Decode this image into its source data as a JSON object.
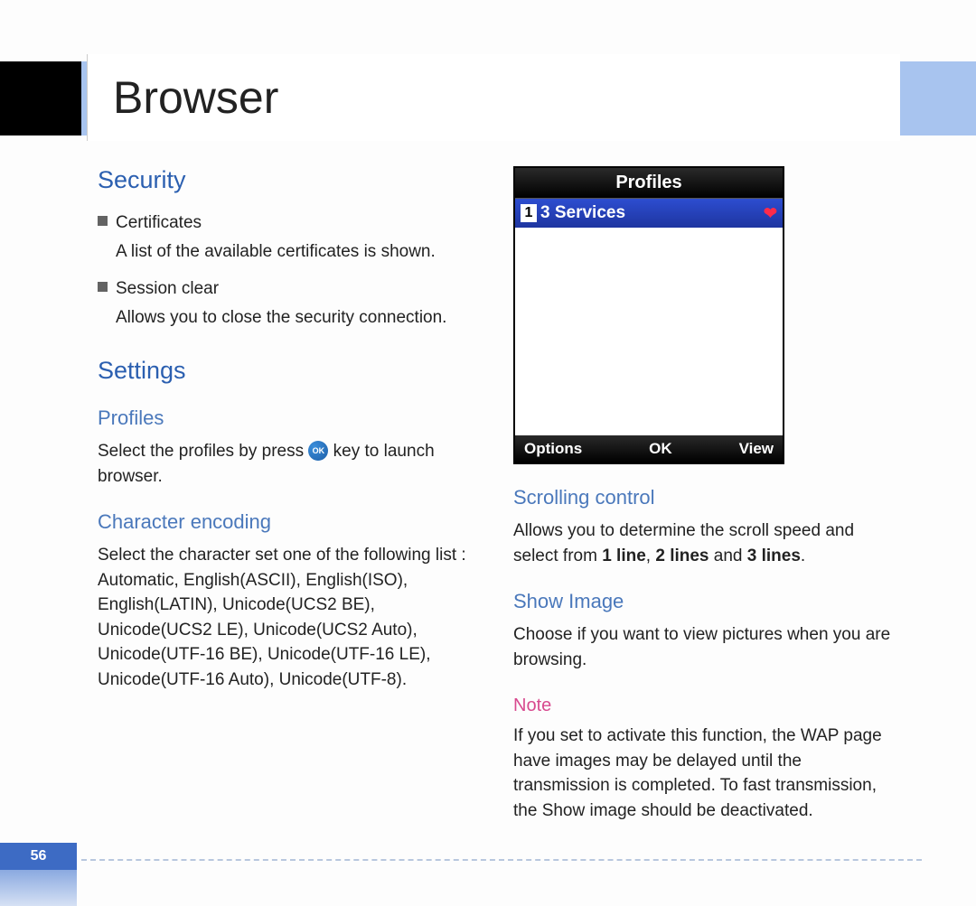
{
  "header": {
    "title": "Browser"
  },
  "left": {
    "security_h": "Security",
    "certificates_label": "Certificates",
    "certificates_desc": "A list of the available certificates is shown.",
    "session_clear_label": "Session clear",
    "session_clear_desc": "Allows you to close the security connection.",
    "settings_h": "Settings",
    "profiles_h": "Profiles",
    "profiles_pre": "Select the profiles by press ",
    "profiles_post": " key to launch browser.",
    "ok_key": "OK",
    "char_enc_h": "Character encoding",
    "char_enc_body": "Select the character set one of the following list : Automatic, English(ASCII), English(ISO), English(LATIN), Unicode(UCS2 BE), Unicode(UCS2 LE), Unicode(UCS2 Auto), Unicode(UTF-16 BE), Unicode(UTF-16 LE), Unicode(UTF-16 Auto), Unicode(UTF-8)."
  },
  "right": {
    "phone": {
      "title": "Profiles",
      "row_num": "1",
      "row_text": "3 Services",
      "soft_left": "Options",
      "soft_mid": "OK",
      "soft_right": "View"
    },
    "scroll_h": "Scrolling control",
    "scroll_pre": "Allows you to determine the scroll speed and select from ",
    "scroll_b1": "1 line",
    "scroll_sep1": ", ",
    "scroll_b2": "2 lines",
    "scroll_sep2": " and ",
    "scroll_b3": "3 lines",
    "scroll_end": ".",
    "show_img_h": "Show Image",
    "show_img_body": "Choose if you want to view pictures when you are browsing.",
    "note_h": "Note",
    "note_body": "If you set to activate this function, the WAP page have images may be delayed until the transmission is completed. To fast transmission, the Show image should be deactivated."
  },
  "page_number": "56"
}
